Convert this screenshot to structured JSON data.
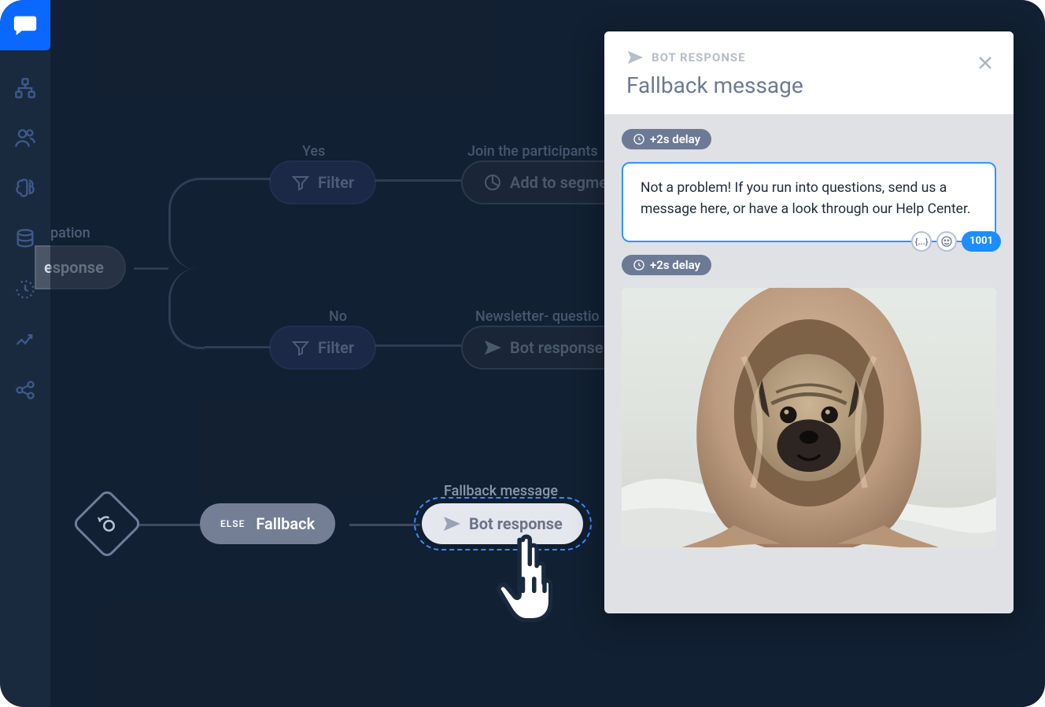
{
  "sidebar": {
    "items": [
      "flow",
      "contacts",
      "brain",
      "database",
      "history",
      "analytics",
      "integrations"
    ]
  },
  "flow": {
    "node_partial_label": "pation",
    "node_partial_pill": "esponse",
    "yes_label": "Yes",
    "no_label": "No",
    "filter_label": "Filter",
    "join_label": "Join the participants",
    "add_segment_label": "Add to segme",
    "newsletter_label": "Newsletter- questio",
    "bot_response_label": "Bot response",
    "else_tag": "ELSE",
    "fallback_label": "Fallback",
    "selected_label": "Bot response",
    "selected_top_label": "Fallback message"
  },
  "panel": {
    "kicker": "BOT RESPONSE",
    "title": "Fallback message",
    "delay1": "+2s delay",
    "message": "Not a problem! If you run into questions, send us a message here, or have a look through our Help Center.",
    "char_counter": "1001",
    "delay2": "+2s delay"
  }
}
